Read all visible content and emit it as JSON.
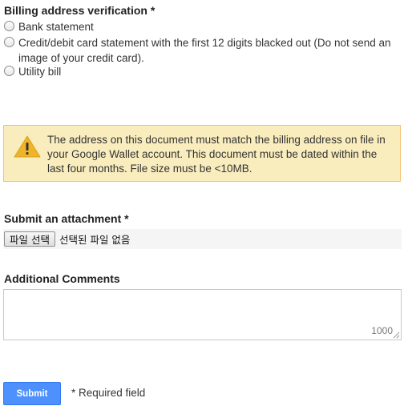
{
  "billing": {
    "label": "Billing address verification *",
    "options": [
      {
        "label": "Bank statement"
      },
      {
        "label": "Credit/debit card statement with the first 12 digits blacked out (Do not send an image of your credit card)."
      },
      {
        "label": "Utility bill"
      }
    ]
  },
  "warning": {
    "icon": "warning-triangle-icon",
    "text": "The address on this document must match the billing address on file in your Google Wallet account. This document must be dated within the last four months. File size must be <10MB."
  },
  "attachment": {
    "label": "Submit an attachment *",
    "button_label": "파일 선택",
    "status_text": "선택된 파일 없음"
  },
  "comments": {
    "label": "Additional Comments",
    "value": "",
    "char_counter": "1000"
  },
  "footer": {
    "submit_label": "Submit",
    "required_note": "* Required field"
  },
  "colors": {
    "warning_bg": "#f9edbe",
    "warning_border": "#f0c36d",
    "submit_bg": "#4d90fe"
  }
}
